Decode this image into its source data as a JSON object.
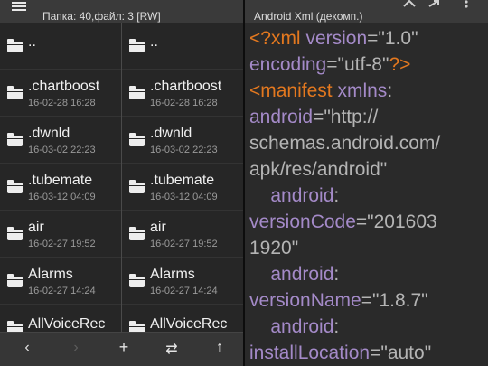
{
  "left_panel": {
    "header_partial": "Папка: 40",
    "header_path": "Папка: 40,файл: 3  [RW]",
    "pane_a": {
      "items": [
        {
          "name": "..",
          "date": ""
        },
        {
          "name": ".chartboost",
          "date": "16-02-28 16:28"
        },
        {
          "name": ".dwnld",
          "date": "16-03-02 22:23"
        },
        {
          "name": ".tubemate",
          "date": "16-03-12 04:09"
        },
        {
          "name": "air",
          "date": "16-02-27 19:52"
        },
        {
          "name": "Alarms",
          "date": "16-02-27 14:24"
        },
        {
          "name": "AllVoiceRec",
          "date": ""
        }
      ]
    },
    "pane_b": {
      "items": [
        {
          "name": "..",
          "date": ""
        },
        {
          "name": ".chartboost",
          "date": "16-02-28 16:28"
        },
        {
          "name": ".dwnld",
          "date": "16-03-02 22:23"
        },
        {
          "name": ".tubemate",
          "date": "16-03-12 04:09"
        },
        {
          "name": "air",
          "date": "16-02-27 19:52"
        },
        {
          "name": "Alarms",
          "date": "16-02-27 14:24"
        },
        {
          "name": "AllVoiceRec",
          "date": ""
        }
      ]
    },
    "bottom_bar": {
      "back": "‹",
      "forward": "›",
      "add": "+",
      "swap": "⇄",
      "up": "↑"
    }
  },
  "right_panel": {
    "title": "Android Xml (декомп.)",
    "icons": [
      "share-icon",
      "more-icon"
    ],
    "code_lines": [
      [
        {
          "t": "<?xml ",
          "c": "orange"
        },
        {
          "t": "version",
          "c": "purple"
        },
        {
          "t": "=\"",
          "c": "punct"
        },
        {
          "t": "1.0",
          "c": "string"
        },
        {
          "t": "\"",
          "c": "punct"
        }
      ],
      [
        {
          "t": "encoding",
          "c": "purple"
        },
        {
          "t": "=\"",
          "c": "punct"
        },
        {
          "t": "utf-8",
          "c": "string"
        },
        {
          "t": "\"",
          "c": "punct"
        },
        {
          "t": "?>",
          "c": "orange"
        }
      ],
      [
        {
          "t": "<manifest ",
          "c": "orange"
        },
        {
          "t": "xmlns",
          "c": "purple"
        },
        {
          "t": ":",
          "c": "punct"
        }
      ],
      [
        {
          "t": "android",
          "c": "purple"
        },
        {
          "t": "=\"",
          "c": "punct"
        },
        {
          "t": "http://",
          "c": "string"
        }
      ],
      [
        {
          "t": "schemas.android.com/",
          "c": "string"
        }
      ],
      [
        {
          "t": "apk/res/android",
          "c": "string"
        },
        {
          "t": "\"",
          "c": "punct"
        }
      ],
      [
        {
          "t": "    android",
          "c": "purple"
        },
        {
          "t": ":",
          "c": "punct"
        }
      ],
      [
        {
          "t": "versionCode",
          "c": "purple"
        },
        {
          "t": "=\"",
          "c": "punct"
        },
        {
          "t": "201603",
          "c": "string"
        }
      ],
      [
        {
          "t": "1920",
          "c": "string"
        },
        {
          "t": "\"",
          "c": "punct"
        }
      ],
      [
        {
          "t": "    android",
          "c": "purple"
        },
        {
          "t": ":",
          "c": "punct"
        }
      ],
      [
        {
          "t": "versionName",
          "c": "purple"
        },
        {
          "t": "=\"",
          "c": "punct"
        },
        {
          "t": "1.8.7",
          "c": "string"
        },
        {
          "t": "\"",
          "c": "punct"
        }
      ],
      [
        {
          "t": "    android",
          "c": "purple"
        },
        {
          "t": ":",
          "c": "punct"
        }
      ],
      [
        {
          "t": "installLocation",
          "c": "purple"
        },
        {
          "t": "=\"",
          "c": "punct"
        },
        {
          "t": "auto",
          "c": "string"
        },
        {
          "t": "\"",
          "c": "punct"
        }
      ]
    ]
  }
}
